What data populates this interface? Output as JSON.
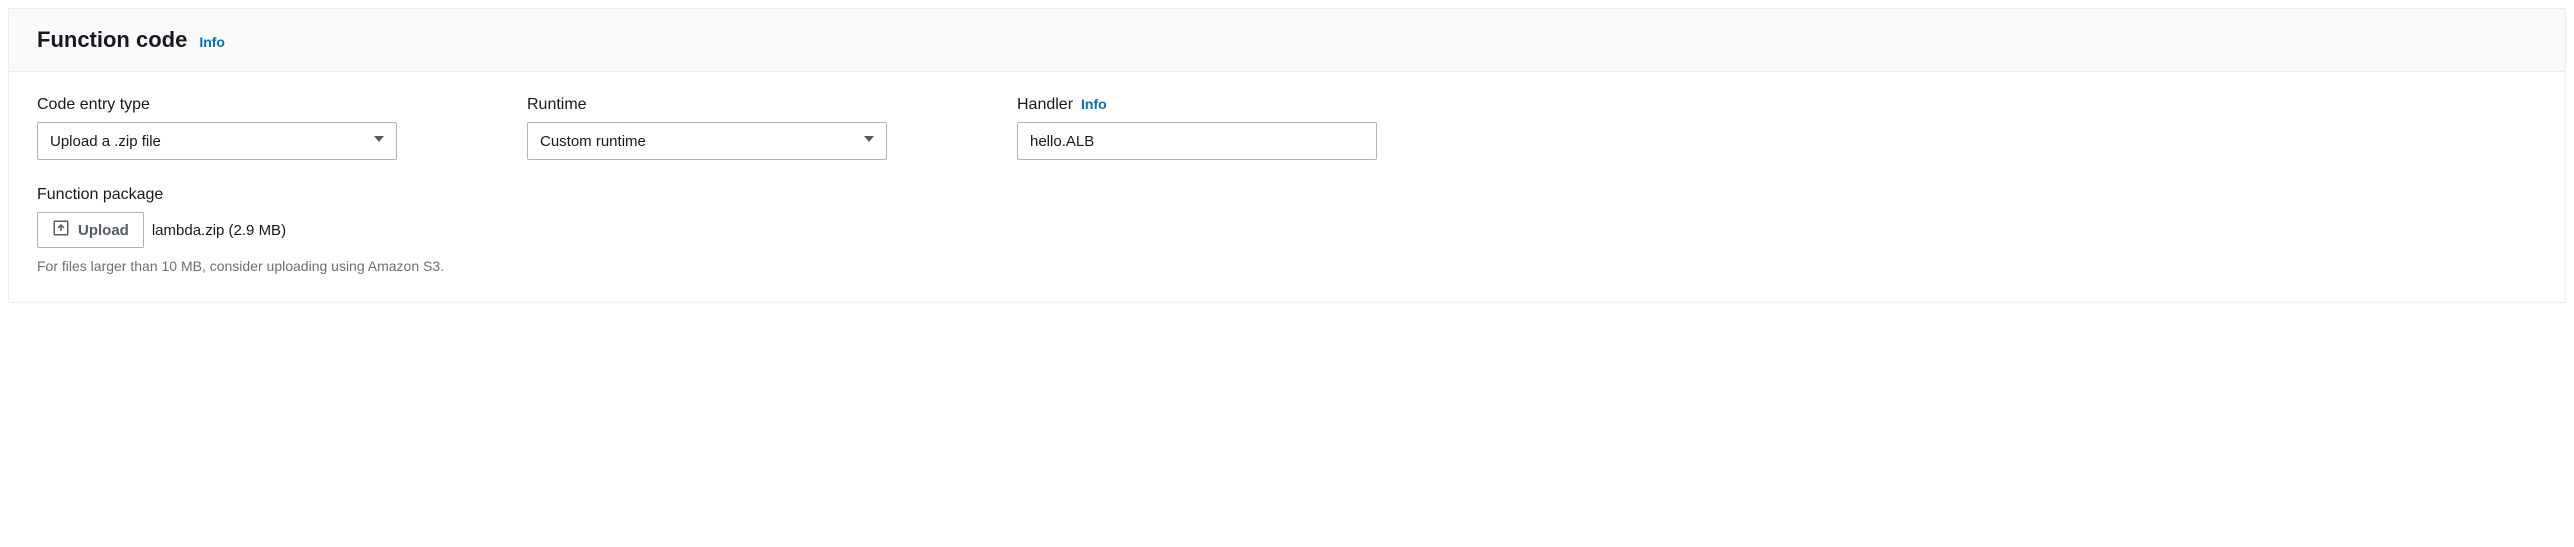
{
  "header": {
    "title": "Function code",
    "info": "Info"
  },
  "fields": {
    "code_entry_type": {
      "label": "Code entry type",
      "value": "Upload a .zip file"
    },
    "runtime": {
      "label": "Runtime",
      "value": "Custom runtime"
    },
    "handler": {
      "label": "Handler",
      "info": "Info",
      "value": "hello.ALB"
    }
  },
  "package": {
    "label": "Function package",
    "upload_button": "Upload",
    "file_display": "lambda.zip (2.9 MB)",
    "hint": "For files larger than 10 MB, consider uploading using Amazon S3."
  }
}
